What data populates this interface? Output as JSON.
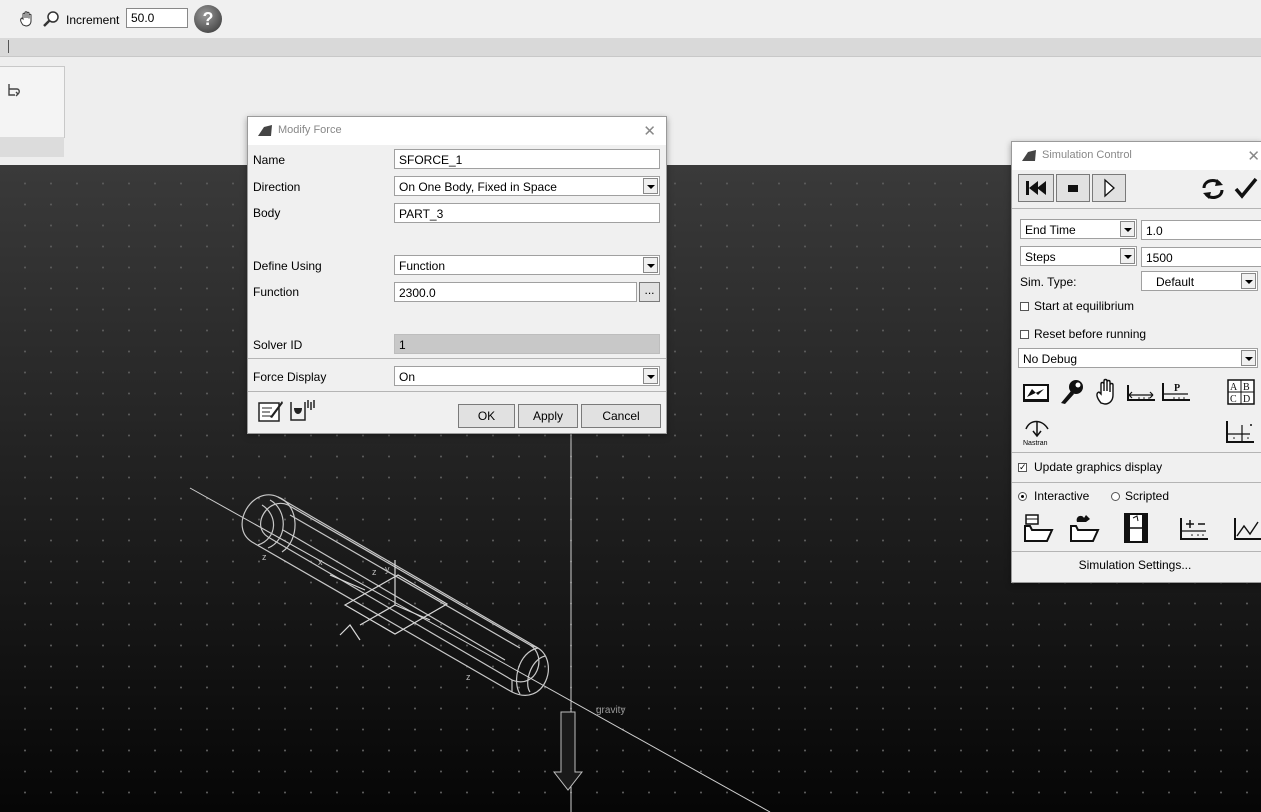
{
  "toolbar": {
    "increment_label": "Increment",
    "increment_value": "50.0",
    "icons": [
      "hand-pan-icon",
      "zoom-icon",
      "help-icon"
    ]
  },
  "modify_force": {
    "title": "Modify Force",
    "fields": {
      "name": {
        "label": "Name",
        "value": "SFORCE_1"
      },
      "direction": {
        "label": "Direction",
        "value": "On One Body, Fixed in Space"
      },
      "body": {
        "label": "Body",
        "value": "PART_3"
      },
      "define_using": {
        "label": "Define Using",
        "value": "Function"
      },
      "function": {
        "label": "Function",
        "value": "2300.0",
        "browse": "..."
      },
      "solver_id": {
        "label": "Solver ID",
        "value": "1"
      },
      "force_display": {
        "label": "Force Display",
        "value": "On"
      }
    },
    "buttons": {
      "ok": "OK",
      "apply": "Apply",
      "cancel": "Cancel"
    },
    "icons": [
      "edit-icon",
      "function-builder-icon"
    ]
  },
  "simulation_control": {
    "title": "Simulation Control",
    "end_time": {
      "option": "End Time",
      "value": "1.0"
    },
    "steps": {
      "option": "Steps",
      "value": "1500"
    },
    "sim_type": {
      "label": "Sim. Type:",
      "value": "Default"
    },
    "start_at_equilibrium": {
      "label": "Start at equilibrium",
      "checked": false
    },
    "reset_before_running": {
      "label": "Reset before running",
      "checked": false
    },
    "debug": {
      "value": "No Debug"
    },
    "nastran_label": "Nastran",
    "update_graphics": {
      "label": "Update graphics display",
      "checked": true
    },
    "mode": {
      "interactive": "Interactive",
      "scripted": "Scripted",
      "selected": "Interactive"
    },
    "settings_button": "Simulation Settings..."
  },
  "viewport": {
    "labels": {
      "gravity": "gravity"
    }
  }
}
